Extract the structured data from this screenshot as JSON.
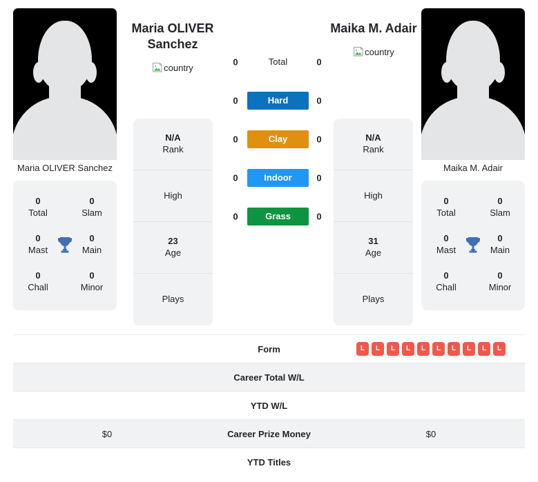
{
  "players": {
    "left": {
      "display_name": "Maria OLIVER Sanchez",
      "header_name": "Maria OLIVER Sanchez",
      "country_alt": "country",
      "photo_alt": "player photo",
      "titles": [
        {
          "value": "0",
          "label": "Total"
        },
        {
          "value": "0",
          "label": "Slam"
        },
        {
          "value": "0",
          "label": "Mast"
        },
        {
          "value": "0",
          "label": "Main"
        },
        {
          "value": "0",
          "label": "Chall"
        },
        {
          "value": "0",
          "label": "Minor"
        }
      ],
      "info": [
        {
          "value": "N/A",
          "label": "Rank"
        },
        {
          "value": "",
          "label": "High"
        },
        {
          "value": "23",
          "label": "Age"
        },
        {
          "value": "",
          "label": "Plays"
        }
      ]
    },
    "right": {
      "display_name": "Maika M. Adair",
      "header_name": "Maika M. Adair",
      "country_alt": "country",
      "photo_alt": "player photo",
      "titles": [
        {
          "value": "0",
          "label": "Total"
        },
        {
          "value": "0",
          "label": "Slam"
        },
        {
          "value": "0",
          "label": "Mast"
        },
        {
          "value": "0",
          "label": "Main"
        },
        {
          "value": "0",
          "label": "Chall"
        },
        {
          "value": "0",
          "label": "Minor"
        }
      ],
      "info": [
        {
          "value": "N/A",
          "label": "Rank"
        },
        {
          "value": "",
          "label": "High"
        },
        {
          "value": "31",
          "label": "Age"
        },
        {
          "value": "",
          "label": "Plays"
        }
      ]
    }
  },
  "surfaces": [
    {
      "label": "Total",
      "left": "0",
      "right": "0",
      "color": "transparent",
      "plain": true
    },
    {
      "label": "Hard",
      "left": "0",
      "right": "0",
      "color": "#0c71bf",
      "plain": false
    },
    {
      "label": "Clay",
      "left": "0",
      "right": "0",
      "color": "#e0900f",
      "plain": false
    },
    {
      "label": "Indoor",
      "left": "0",
      "right": "0",
      "color": "#2196f3",
      "plain": false
    },
    {
      "label": "Grass",
      "left": "0",
      "right": "0",
      "color": "#0d9440",
      "plain": false
    }
  ],
  "table": {
    "rows": [
      {
        "label": "Form",
        "left": "",
        "right": "",
        "left_form": [],
        "right_form": [
          "L",
          "L",
          "L",
          "L",
          "L",
          "L",
          "L",
          "L",
          "L",
          "L"
        ]
      },
      {
        "label": "Career Total W/L",
        "left": "",
        "right": "",
        "left_form": [],
        "right_form": []
      },
      {
        "label": "YTD W/L",
        "left": "",
        "right": "",
        "left_form": [],
        "right_form": []
      },
      {
        "label": "Career Prize Money",
        "left": "$0",
        "right": "$0",
        "left_form": [],
        "right_form": []
      },
      {
        "label": "YTD Titles",
        "left": "",
        "right": "",
        "left_form": [],
        "right_form": []
      }
    ]
  },
  "colors": {
    "hard": "#0c71bf",
    "clay": "#e0900f",
    "indoor": "#2196f3",
    "grass": "#0d9440",
    "loss_badge": "#f1584a",
    "trophy": "#3f6fb5",
    "card_bg": "#f1f2f3"
  }
}
